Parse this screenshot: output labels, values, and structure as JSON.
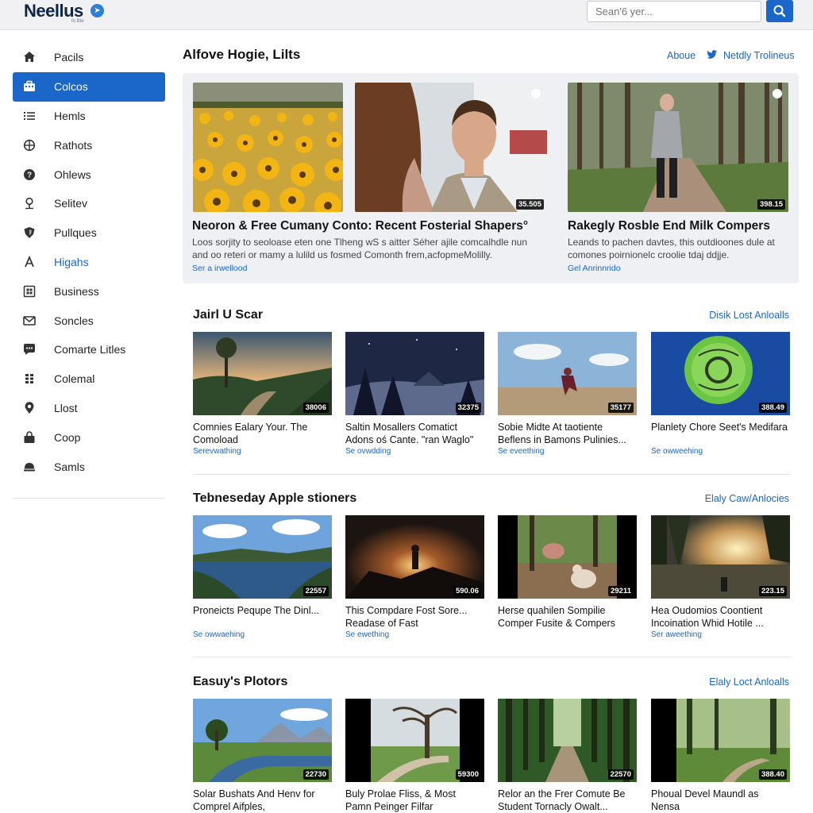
{
  "header": {
    "logo": "Neellus",
    "logo_tag": "fo Bte",
    "search_placeholder": "Sean'6 yer..."
  },
  "sidebar": {
    "items": [
      {
        "label": "Pacils",
        "icon": "home-icon"
      },
      {
        "label": "Colcos",
        "icon": "briefcase-icon",
        "active": true
      },
      {
        "label": "Hemls",
        "icon": "list-icon"
      },
      {
        "label": "Rathots",
        "icon": "globe-icon"
      },
      {
        "label": "Ohlews",
        "icon": "help-icon"
      },
      {
        "label": "Selitev",
        "icon": "pin-icon"
      },
      {
        "label": "Pullques",
        "icon": "shield-icon"
      },
      {
        "label": "Higahs",
        "icon": "text-icon"
      },
      {
        "label": "Business",
        "icon": "grid-icon"
      },
      {
        "label": "Soncles",
        "icon": "mail-icon"
      },
      {
        "label": "Comarte Litles",
        "icon": "chat-icon"
      },
      {
        "label": "Colemal",
        "icon": "dots-icon"
      },
      {
        "label": "Llost",
        "icon": "location-icon"
      },
      {
        "label": "Coop",
        "icon": "bag-icon"
      },
      {
        "label": "Samls",
        "icon": "hat-icon"
      }
    ]
  },
  "main": {
    "title": "Alfove Hogie, Lilts",
    "link_about": "Aboue",
    "link_twitter": "Netdly Trolineus",
    "featured": [
      {
        "title": "Neoron & Free Cumany Conto: Recent Fosterial Shapers°",
        "desc": "Loos sorjity to seoloase eten one Tlheng wS s aitter Séher ajile comcalhdle nun and oo reteri or mamy a lulild us fosmed Comonth frem,acfopmeMolilly.",
        "link": "Ser a irwellood",
        "duration": "35.505"
      },
      {
        "title": "Rakegly Rosble End Milk Compers",
        "desc": "Leands to pachen davtes, this outdioones dule at comones poirnionelc croolie tdaj ddjje.",
        "link": "Gel Anrinnrido",
        "duration": "398.15"
      }
    ],
    "sections": [
      {
        "title": "Jairl U Scar",
        "link": "Disik Lost Anloalls",
        "cards": [
          {
            "title": "Comnies Ealary Your. The Comoload",
            "meta": "Serevwathing",
            "duration": "38006"
          },
          {
            "title": "Saltin Mosallers Comatict Adons oś Cante. \"ran Waglo\"",
            "meta": "Se ovwdding",
            "duration": "32375"
          },
          {
            "title": "Sobie Midte At taotiente Beflens in Bamons Pulinies...",
            "meta": "Se eveething",
            "duration": "35177"
          },
          {
            "title": "Planlety Chore Seet's Medifara",
            "meta": "Se owweehing",
            "duration": "388.49"
          }
        ]
      },
      {
        "title": "Tebneseday Apple stioners",
        "link": "Elaly Caw/Anlocies",
        "cards": [
          {
            "title": "Proneicts Pequpe The Dinl...",
            "meta": "Se owwaehing",
            "duration": "22557"
          },
          {
            "title": "This Compdare Fost Sore... Readase of Fast",
            "meta": "Se ewething",
            "duration": "590.06"
          },
          {
            "title": "Herse quahilen Sompilie Comper Fusite & Compers",
            "meta": "",
            "duration": "29211"
          },
          {
            "title": "Hea Oudomios Coontient Incoination Whid Hotile ...",
            "meta": "Ser aweething",
            "duration": "223.15"
          }
        ]
      },
      {
        "title": "Easuy's Plotors",
        "link": "Elaly Loct Anloalls",
        "cards": [
          {
            "title": "Solar Bushats And Henv for Comprel Aifples,",
            "meta": "",
            "duration": "22730"
          },
          {
            "title": "Buly Prolae Fliss, & Most Pamn Peinger Filfar",
            "meta": "",
            "duration": "59300"
          },
          {
            "title": "Relor an the Frer Comute Be Student Tornacly Owalt...",
            "meta": "",
            "duration": "22570"
          },
          {
            "title": "Phoual Devel Maundl as Nensa",
            "meta": "",
            "duration": "388.40"
          }
        ]
      }
    ]
  }
}
